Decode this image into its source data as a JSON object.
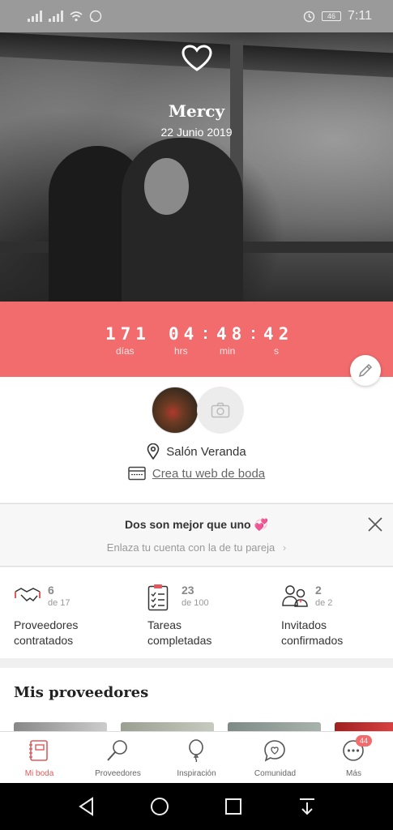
{
  "status_bar": {
    "time": "7:11",
    "battery": "46"
  },
  "hero": {
    "name": "Mercy",
    "date": "22 Junio 2019"
  },
  "countdown": {
    "days": "171",
    "hours": "04",
    "minutes": "48",
    "seconds": "42",
    "days_label": "días",
    "hours_label": "hrs",
    "minutes_label": "min",
    "seconds_label": "s"
  },
  "profile": {
    "venue": "Salón Veranda",
    "web_link": "Crea tu web de boda"
  },
  "promo": {
    "title": "Dos son mejor que uno 💞",
    "subtitle": "Enlaza tu cuenta con la de tu pareja"
  },
  "stats": [
    {
      "value": "6",
      "of": "de 17",
      "label_line1": "Proveedores",
      "label_line2": "contratados",
      "icon": "handshake-icon"
    },
    {
      "value": "23",
      "of": "de 100",
      "label_line1": "Tareas",
      "label_line2": "completadas",
      "icon": "checklist-icon"
    },
    {
      "value": "2",
      "of": "de 2",
      "label_line1": "Invitados",
      "label_line2": "confirmados",
      "icon": "guests-icon"
    }
  ],
  "providers_section": {
    "title": "Mis proveedores"
  },
  "tabs": [
    {
      "label": "Mi boda",
      "icon": "notebook-icon",
      "active": true
    },
    {
      "label": "Proveedores",
      "icon": "search-icon",
      "active": false
    },
    {
      "label": "Inspiración",
      "icon": "balloon-icon",
      "active": false
    },
    {
      "label": "Comunidad",
      "icon": "chat-heart-icon",
      "active": false
    },
    {
      "label": "Más",
      "icon": "more-icon",
      "active": false,
      "badge": "44"
    }
  ],
  "colors": {
    "accent": "#f26b6d",
    "active_tab": "#e1595c"
  }
}
